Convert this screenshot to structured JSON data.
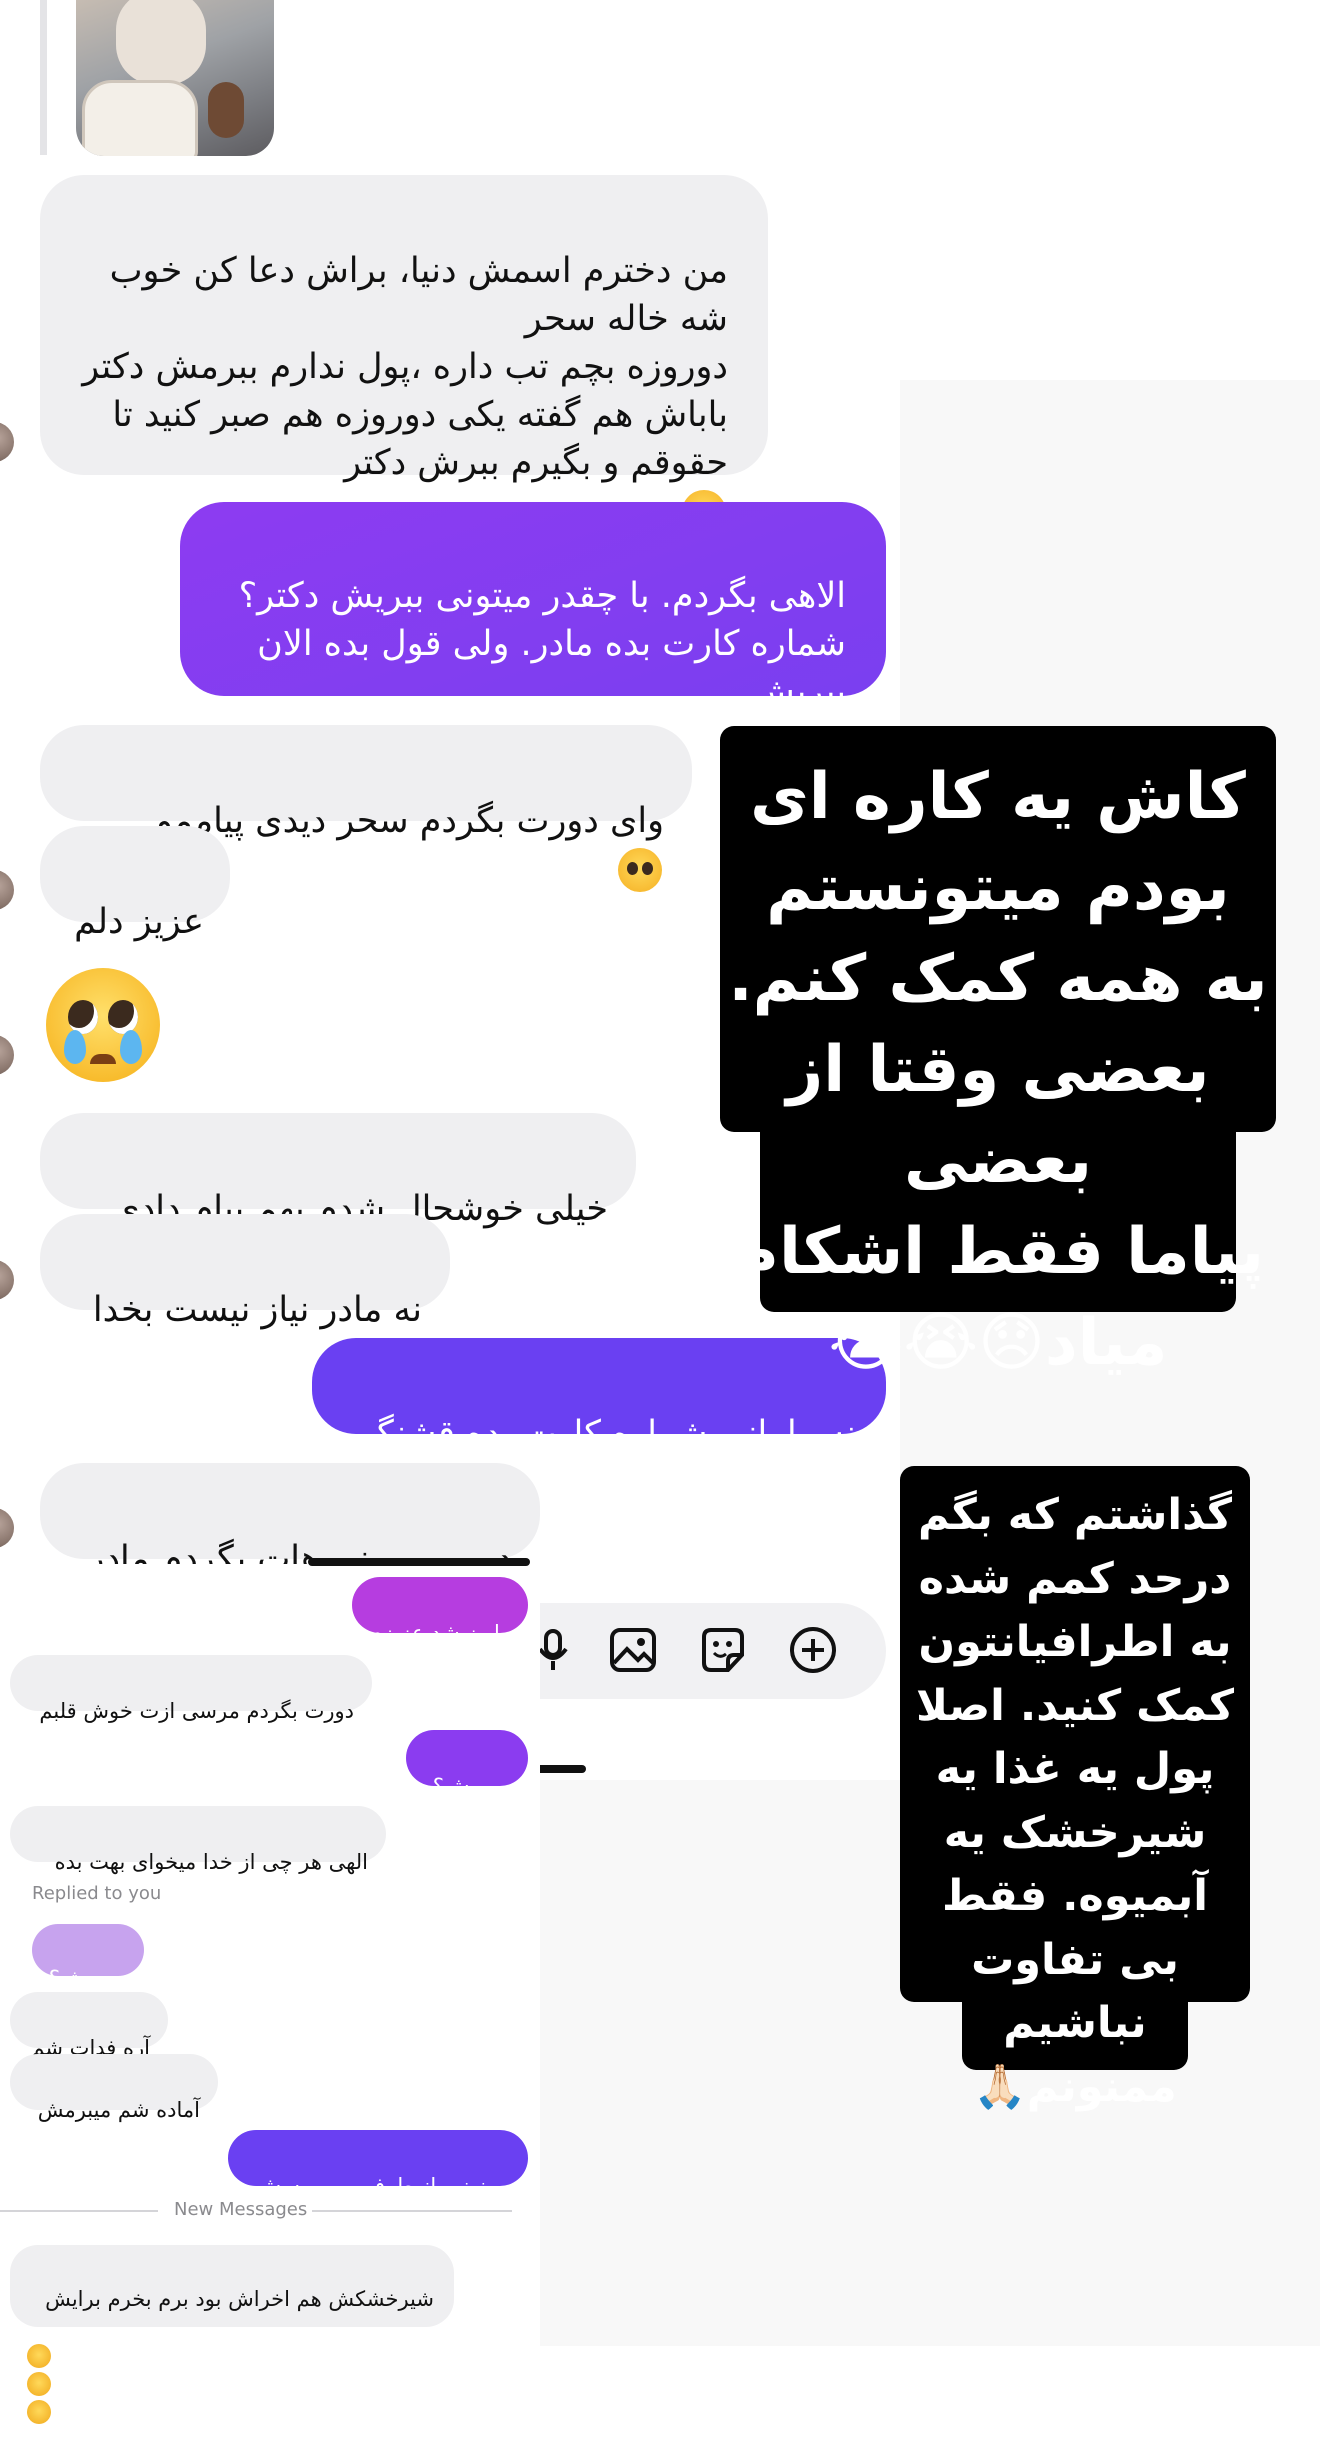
{
  "thread": {
    "messages": [
      {
        "from": "them",
        "text": "من دخترم اسمش دنیا، براش دعا کن خوب\nشه خاله سحر\nدوروزه بچم تب داره ،پول ندارم ببرمش دکتر\nباباش هم گفته یکی دوروزه هم صبر کنید تا\nحقوقم و بگیرم ببرش دکتر"
      },
      {
        "from": "me",
        "text": "الاهی بگردم. با چقدر میتونی ببریش دکتر؟\nشماره کارت بده مادر. ولی قول بده الان\nببریش."
      },
      {
        "from": "them",
        "text": "وای دورت بگردم سحر دیدی پیاممو"
      },
      {
        "from": "them",
        "text": "عزیز دلم"
      },
      {
        "from": "them",
        "text": "خیلی خوشحال شدم بهم پیام دادی"
      },
      {
        "from": "them",
        "text": "نه مادر نیاز نیست بخدا"
      },
      {
        "from": "me",
        "text": "نه مامانی شماره کارت بده قشنگم"
      },
      {
        "from": "them",
        "text": "دور مهربونی هات بگردم مادر"
      }
    ]
  },
  "overlay_texts": {
    "story_top": "کاش یه کاره ای\nبودم میتونستم\nبه همه کمک کنم.\nبعضی وقتا از بعضی\nپیاما فقط اشکام\nمیاد😞😭😭",
    "story_bottom": "گذاشتم که بگم\nدرحد کمم شده\nبه اطرافیانتون\nکمک کنید. اصلا\nپول یه غذا یه\nشیرخشک یه\nآبمیوه. فقط\nبی تفاوت نباشیم\nممنونم🙏🏻"
  },
  "mini_thread": {
    "messages": [
      {
        "from": "me",
        "text": "واریز شد عزیزم"
      },
      {
        "from": "them",
        "text": "دورت بگردم مرسی ازت خوش قلبم"
      },
      {
        "from": "me",
        "text": "میبریش؟"
      },
      {
        "from": "them",
        "text": "الهی هر چی از خدا میخوای بهت بده"
      },
      {
        "from": "reply_context",
        "text": "میبریش؟"
      },
      {
        "from": "them",
        "text": "آره فدات شم"
      },
      {
        "from": "them",
        "text": "آماده شم میبرمش"
      },
      {
        "from": "me",
        "text": "ممنونم. از طرف من ببوسش"
      },
      {
        "from": "them",
        "text": "شیرخشکش هم اخراش بود برم بخرم برایش"
      }
    ],
    "replied_label": "Replied to you",
    "new_messages_label": "New Messages"
  },
  "composer_icons": [
    "microphone-icon",
    "image-icon",
    "sticker-icon",
    "plus-icon"
  ],
  "colors": {
    "incoming_bubble": "#efeff1",
    "outgoing_purple": "#8b3cf0",
    "outgoing_violet": "#6a40f2",
    "outgoing_magenta": "#a83be6",
    "story_background": "#000000"
  }
}
